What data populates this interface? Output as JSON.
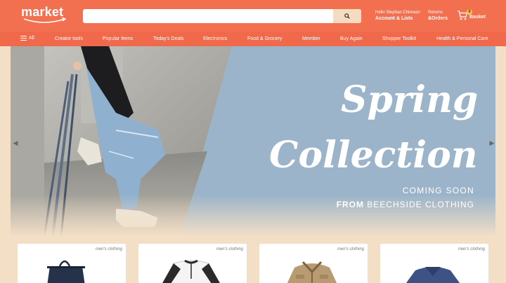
{
  "header": {
    "logo": "market",
    "search": {
      "placeholder": "",
      "value": ""
    },
    "account": {
      "greeting": "Hello Stephan Chiorean",
      "label": "Account & Lists"
    },
    "returns": {
      "line1": "Returns",
      "line2": "&Orders"
    },
    "basket": {
      "count": "0",
      "label": "Basket"
    }
  },
  "nav": {
    "all_label": "All",
    "items": [
      "Creator tools",
      "Popular Items",
      "Today's Deals",
      "Electronics",
      "Food & Grocery",
      "Member",
      "Buy Again",
      "Shopper Toolkit",
      "Health & Personal Care"
    ]
  },
  "hero": {
    "line1": "Spring",
    "line2": "Collection",
    "coming": "COMING SOON",
    "from_prefix": "FROM",
    "from_brand": "BEECHSIDE CLOTHING"
  },
  "products": [
    {
      "tag": "men's clothing",
      "icon": "bag-icon"
    },
    {
      "tag": "men's clothing",
      "icon": "raglan-shirt-icon"
    },
    {
      "tag": "men's clothing",
      "icon": "jacket-icon"
    },
    {
      "tag": "men's clothing",
      "icon": "sweater-icon"
    }
  ],
  "colors": {
    "header": "#f26f50",
    "nav": "#f0694a",
    "hero_bg": "#9bb4c9",
    "page_bg": "#f3dfc6",
    "search_btn": "#f3dcc1"
  }
}
